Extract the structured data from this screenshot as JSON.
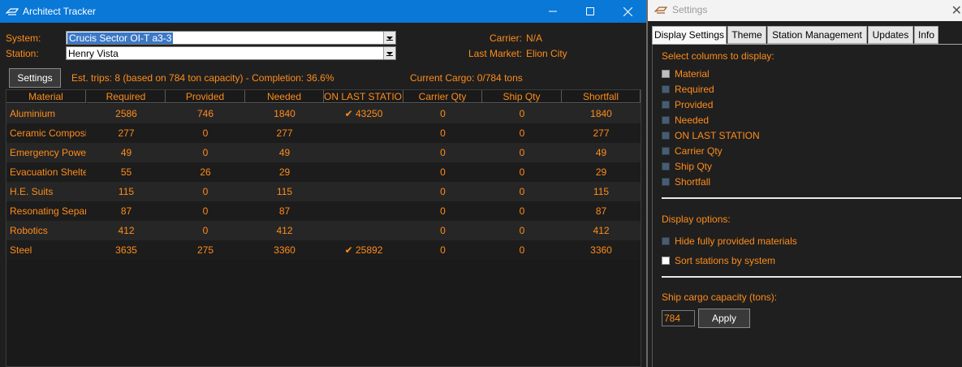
{
  "main_window": {
    "title": "Architect Tracker",
    "system_label": "System:",
    "system_value": "Crucis Sector OI-T a3-3",
    "station_label": "Station:",
    "station_value": "Henry Vista",
    "carrier_label": "Carrier:",
    "carrier_value": "N/A",
    "last_market_label": "Last Market:",
    "last_market_value": "Elion City",
    "settings_button": "Settings",
    "est_trips_text": "Est. trips: 8 (based on 784 ton capacity) - Completion: 36.6%",
    "current_cargo_text": "Current Cargo: 0/784 tons",
    "colors": {
      "accent": "#ff8c1a",
      "titlebar": "#0a78d7"
    }
  },
  "table": {
    "headers": [
      "Material",
      "Required",
      "Provided",
      "Needed",
      "ON LAST STATION",
      "Carrier Qty",
      "Ship Qty",
      "Shortfall"
    ],
    "rows": [
      [
        "Aluminium",
        "2586",
        "746",
        "1840",
        "✔ 43250",
        "0",
        "0",
        "1840"
      ],
      [
        "Ceramic Composites",
        "277",
        "0",
        "277",
        "",
        "0",
        "0",
        "277"
      ],
      [
        "Emergency Power Cells",
        "49",
        "0",
        "49",
        "",
        "0",
        "0",
        "49"
      ],
      [
        "Evacuation Shelter",
        "55",
        "26",
        "29",
        "",
        "0",
        "0",
        "29"
      ],
      [
        "H.E. Suits",
        "115",
        "0",
        "115",
        "",
        "0",
        "0",
        "115"
      ],
      [
        "Resonating Separators",
        "87",
        "0",
        "87",
        "",
        "0",
        "0",
        "87"
      ],
      [
        "Robotics",
        "412",
        "0",
        "412",
        "",
        "0",
        "0",
        "412"
      ],
      [
        "Steel",
        "3635",
        "275",
        "3360",
        "✔ 25892",
        "0",
        "0",
        "3360"
      ]
    ]
  },
  "settings_window": {
    "title": "Settings",
    "close_glyph": "✕",
    "tabs": [
      "Display Settings",
      "Theme",
      "Station Management",
      "Updates",
      "Info"
    ],
    "active_tab": "Display Settings",
    "columns_label": "Select columns to display:",
    "columns": [
      {
        "label": "Material",
        "checked": true
      },
      {
        "label": "Required",
        "checked": false
      },
      {
        "label": "Provided",
        "checked": false
      },
      {
        "label": "Needed",
        "checked": false
      },
      {
        "label": "ON LAST STATION",
        "checked": false
      },
      {
        "label": "Carrier Qty",
        "checked": false
      },
      {
        "label": "Ship Qty",
        "checked": false
      },
      {
        "label": "Shortfall",
        "checked": false
      }
    ],
    "display_options_label": "Display options:",
    "options": [
      {
        "label": "Hide fully provided materials",
        "checked": false
      },
      {
        "label": "Sort stations by system",
        "checked": false
      }
    ],
    "capacity_label": "Ship cargo capacity (tons):",
    "capacity_value": "784",
    "apply_button": "Apply"
  }
}
